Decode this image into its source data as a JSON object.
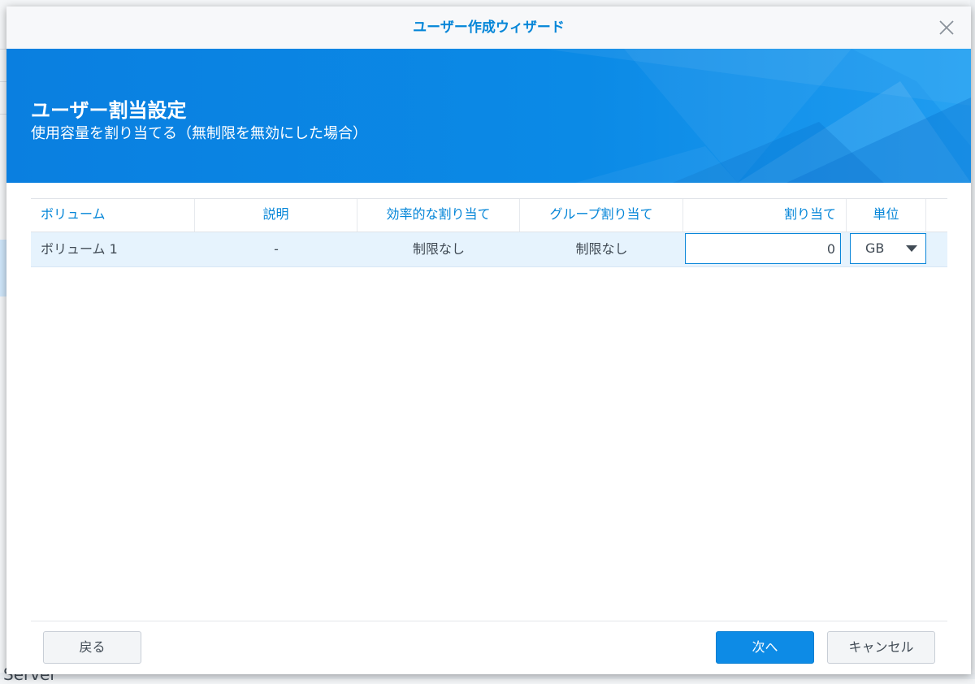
{
  "dialog": {
    "title": "ユーザー作成ウィザード",
    "close_icon": "close-icon"
  },
  "banner": {
    "title": "ユーザー割当設定",
    "subtitle": "使用容量を割り当てる（無制限を無効にした場合）"
  },
  "grid": {
    "columns": [
      "ボリューム",
      "説明",
      "効率的な割り当て",
      "グループ割り当て",
      "割り当て",
      "単位"
    ],
    "rows": [
      {
        "volume": "ボリューム 1",
        "description": "-",
        "effective_quota": "制限なし",
        "group_quota": "制限なし",
        "quota_value": "0",
        "unit": "GB"
      }
    ]
  },
  "footer": {
    "back_label": "戻る",
    "next_label": "次へ",
    "cancel_label": "キャンセル"
  },
  "background": {
    "server_label": "Server"
  },
  "colors": {
    "accent": "#0586d8",
    "banner": "#0b8ae6",
    "row_selected": "#e6f3fd",
    "primary_button": "#0d8be6"
  }
}
